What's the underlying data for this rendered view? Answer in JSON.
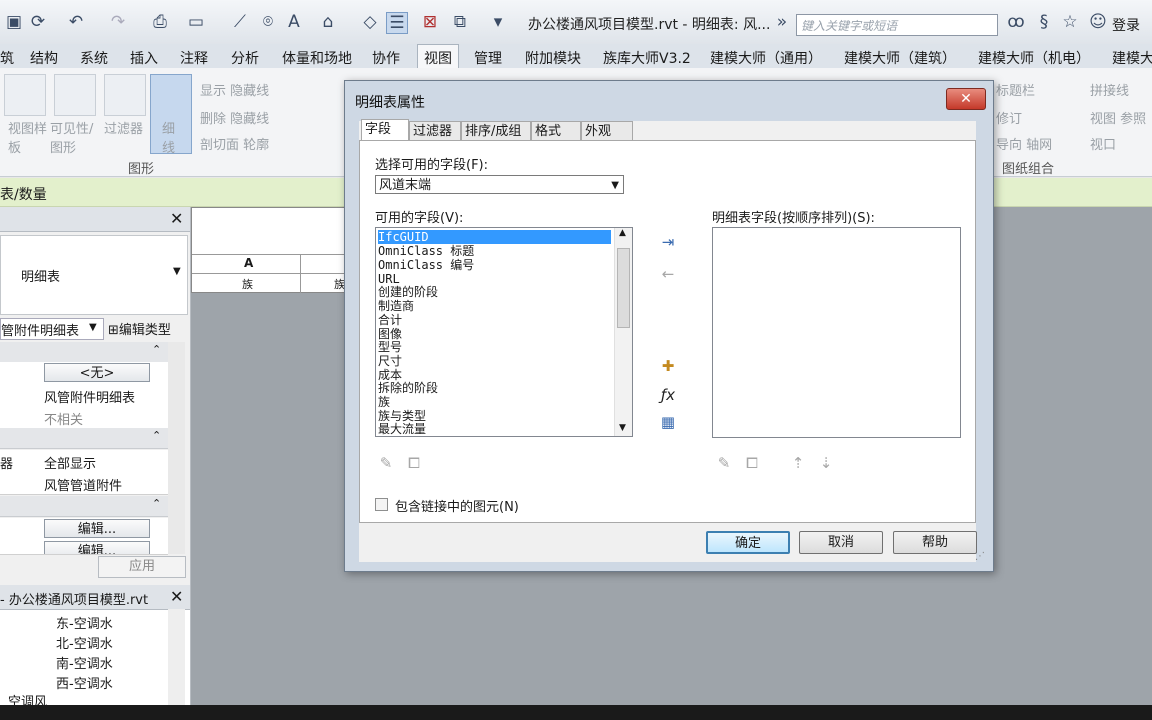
{
  "app": {
    "document_title": "办公楼通风项目模型.rvt - 明细表: 风...",
    "search_placeholder": "键入关键字或短语",
    "login_label": "登录"
  },
  "ribbon_tabs": [
    "筑",
    "结构",
    "系统",
    "插入",
    "注释",
    "分析",
    "体量和场地",
    "协作",
    "视图",
    "管理",
    "附加模块",
    "族库大师V3.2",
    "建模大师（通用）",
    "建模大师（建筑）",
    "建模大师（机电）",
    "建模大师"
  ],
  "ribbon": {
    "big_buttons": [
      "视图样板",
      "可见性/图形",
      "过滤器",
      "细线"
    ],
    "small_items": [
      "显示 隐藏线",
      "删除 隐藏线",
      "剖切面 轮廓"
    ],
    "right_items": [
      "标题栏",
      "修订",
      "导向 轴网",
      "拼接线",
      "视图 参照",
      "视口"
    ],
    "groups": [
      "图形",
      "图纸组合"
    ]
  },
  "context_bar": {
    "label": "表/数量"
  },
  "properties": {
    "type_name": "明细表",
    "type_selector": "管附件明细表",
    "edit_type_label": "编辑类型",
    "rows": [
      {
        "key": "",
        "value": "<无>",
        "kind": "button"
      },
      {
        "key": "",
        "value": "风管附件明细表",
        "kind": "text"
      },
      {
        "key": "",
        "value": "不相关",
        "kind": "grey"
      },
      {
        "key": "器",
        "value": "全部显示",
        "kind": "text"
      },
      {
        "key": "",
        "value": "风管管道附件",
        "kind": "text"
      },
      {
        "key": "",
        "value": "编辑...",
        "kind": "button"
      },
      {
        "key": "",
        "value": "编辑...",
        "kind": "button"
      }
    ],
    "apply_label": "应用"
  },
  "project_browser": {
    "title": "- 办公楼通风项目模型.rvt",
    "items": [
      "东-空调水",
      "北-空调水",
      "南-空调水",
      "西-空调水"
    ],
    "parent_item": "空调风"
  },
  "schedule_view": {
    "column_header": "A",
    "cell_values": [
      "族",
      "族"
    ]
  },
  "dialog": {
    "title": "明细表属性",
    "close_label": "✕",
    "tabs": [
      "字段",
      "过滤器",
      "排序/成组",
      "格式",
      "外观"
    ],
    "active_tab": "字段",
    "select_fields_label": "选择可用的字段(F):",
    "field_source": "风道末端",
    "available_label": "可用的字段(V):",
    "available_fields": [
      "IfcGUID",
      "OmniClass 标题",
      "OmniClass 编号",
      "URL",
      "创建的阶段",
      "制造商",
      "合计",
      "图像",
      "型号",
      "尺寸",
      "成本",
      "拆除的阶段",
      "族",
      "族与类型",
      "最大流量"
    ],
    "selected_index": 0,
    "schedule_fields_label": "明细表字段(按顺序排列)(S):",
    "include_links_label": "包含链接中的图元(N)",
    "include_links_checked": false,
    "ok_label": "确定",
    "cancel_label": "取消",
    "help_label": "帮助"
  }
}
